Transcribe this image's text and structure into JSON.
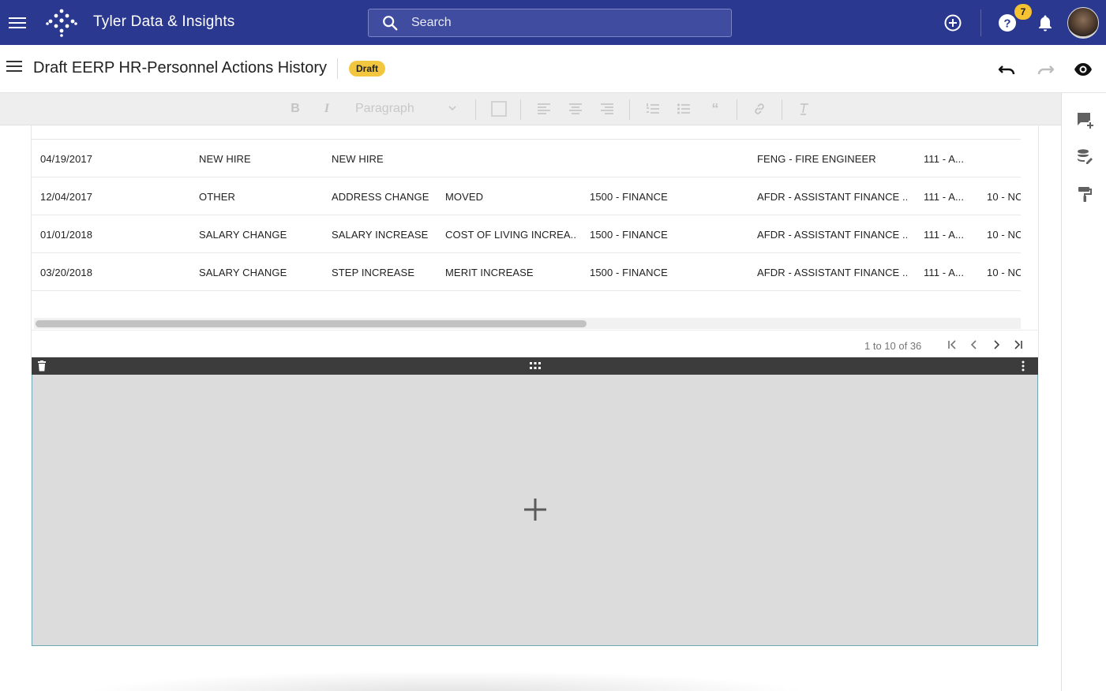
{
  "app": {
    "title": "Tyler Data & Insights",
    "notification_count": "7",
    "colors": {
      "appbar": "#2a388f",
      "badge": "#f5c331"
    }
  },
  "search": {
    "placeholder": "Search"
  },
  "document": {
    "title": "Draft EERP HR-Personnel Actions History",
    "status_badge": "Draft"
  },
  "toolbar": {
    "paragraph_label": "Paragraph"
  },
  "table": {
    "rows": [
      {
        "date": "04/19/2017",
        "action": "NEW HIRE",
        "reason": "NEW HIRE",
        "detail": "",
        "department": "",
        "position": "FENG - FIRE ENGINEER",
        "fund": "111 - A...",
        "extra": ""
      },
      {
        "date": "12/04/2017",
        "action": "OTHER",
        "reason": "ADDRESS CHANGE",
        "detail": "MOVED",
        "department": "1500 - FINANCE",
        "position": "AFDR - ASSISTANT FINANCE ...",
        "fund": "111 - A...",
        "extra": "10 - NC"
      },
      {
        "date": "01/01/2018",
        "action": "SALARY CHANGE",
        "reason": "SALARY INCREASE",
        "detail": "COST OF LIVING INCREA...",
        "department": "1500 - FINANCE",
        "position": "AFDR - ASSISTANT FINANCE ...",
        "fund": "111 - A...",
        "extra": "10 - NC"
      },
      {
        "date": "03/20/2018",
        "action": "SALARY CHANGE",
        "reason": "STEP INCREASE",
        "detail": "MERIT INCREASE",
        "department": "1500 - FINANCE",
        "position": "AFDR - ASSISTANT FINANCE ...",
        "fund": "111 - A...",
        "extra": "10 - NC"
      }
    ],
    "pagination": {
      "range_text": "1 to 10 of 36"
    }
  }
}
